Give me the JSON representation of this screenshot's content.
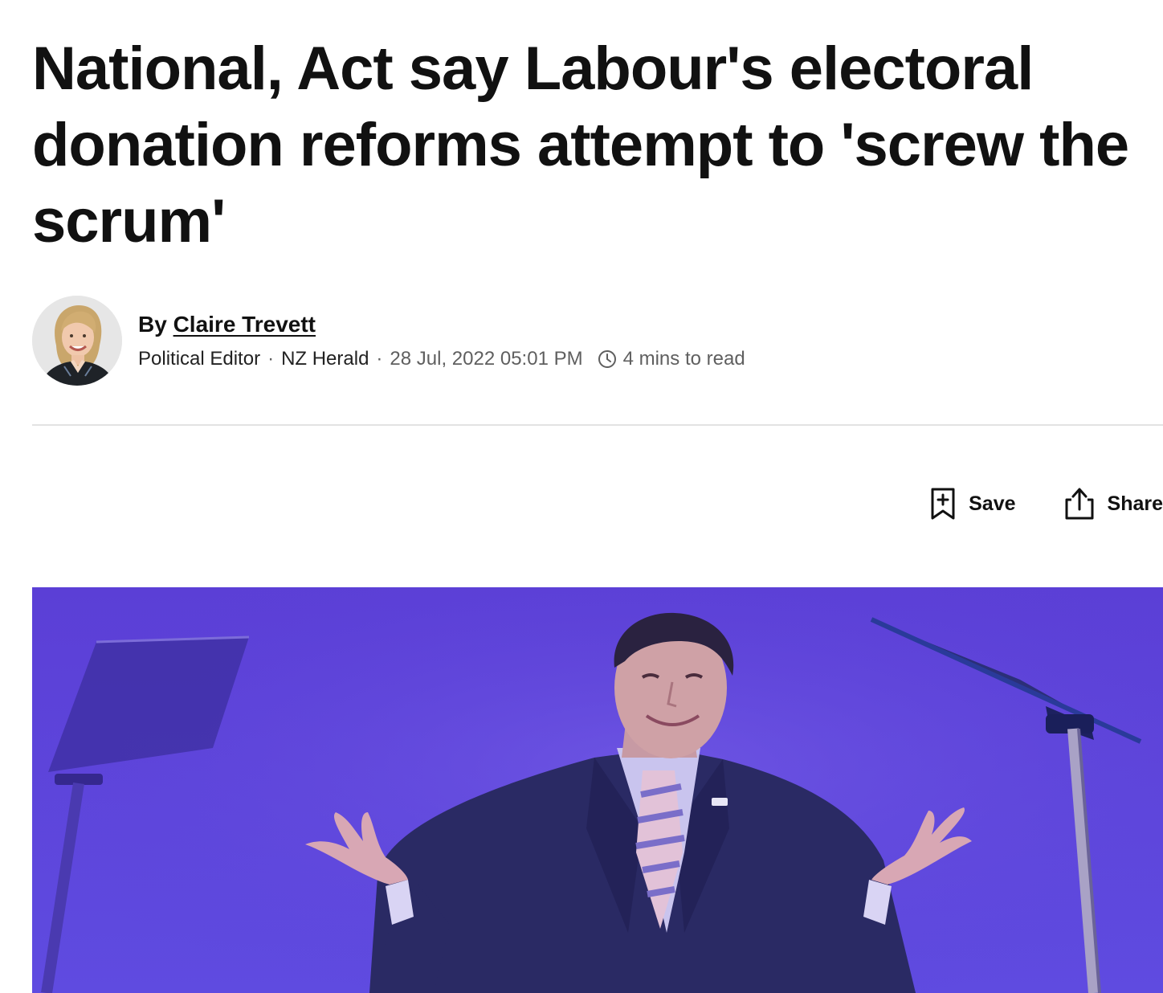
{
  "article": {
    "headline": "National, Act say Labour's electoral donation reforms attempt to 'screw the scrum'"
  },
  "byline": {
    "by_label": "By",
    "author_name": "Claire Trevett",
    "role": "Political Editor",
    "separator": "·",
    "publication": "NZ Herald",
    "date": "28 Jul, 2022 05:01 PM",
    "read_time": "4 mins to read",
    "clock_icon": "clock-icon"
  },
  "actions": {
    "save_label": "Save",
    "save_icon": "bookmark-plus-icon",
    "share_label": "Share",
    "share_icon": "share-icon"
  },
  "colors": {
    "text": "#111111",
    "muted": "#5f5f5f",
    "divider": "#e3e3e3",
    "hero_background": "#5a3fd8"
  }
}
